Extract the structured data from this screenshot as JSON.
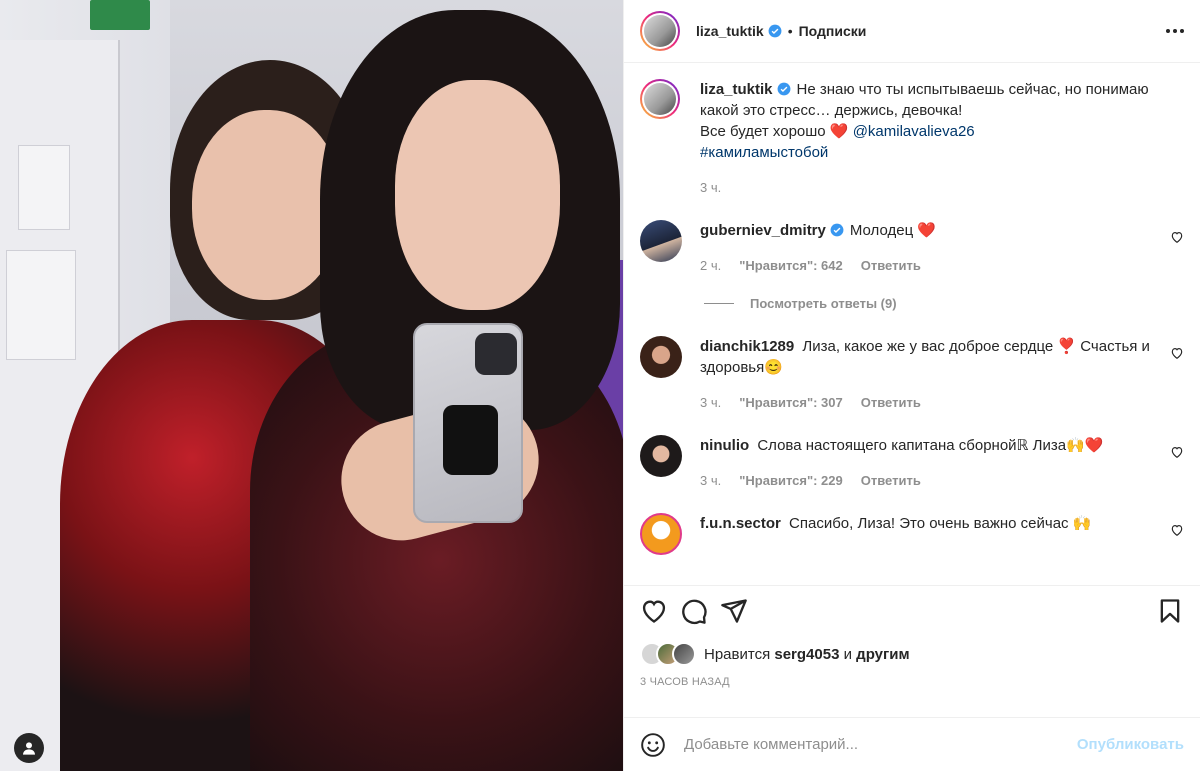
{
  "post": {
    "author": "liza_tuktik",
    "follow_label": "Подписки",
    "caption_line1": "Не знаю что ты испытываешь сейчас, но понимаю",
    "caption_line2": "какой это стресс… держись, девочка!",
    "caption_line3": "Все будет хорошо",
    "caption_heart": "❤️",
    "caption_mention": "@kamilavalieva26",
    "caption_hashtag": "#камиламыстобой",
    "caption_time": "3 ч."
  },
  "comments": [
    {
      "user": "guberniev_dmitry",
      "verified": true,
      "text": "Молодец",
      "emoji": "❤️",
      "time": "2 ч.",
      "likes": "\"Нравится\": 642",
      "reply": "Ответить"
    },
    {
      "user": "dianchik1289",
      "text": "Лиза, какое же у вас доброе сердце ❣️ Счастья и здоровья😊",
      "time": "3 ч.",
      "likes": "\"Нравится\": 307",
      "reply": "Ответить"
    },
    {
      "user": "ninulio",
      "text": "Слова настоящего капитана сборнойℝ Лиза🙌❤️",
      "time": "3 ч.",
      "likes": "\"Нравится\": 229",
      "reply": "Ответить"
    },
    {
      "user": "f.u.n.sector",
      "text": "Спасибо, Лиза! Это очень важно сейчас 🙌"
    }
  ],
  "view_replies": "Посмотреть ответы (9)",
  "likes": {
    "prefix": "Нравится",
    "user": "serg4053",
    "middle": "и",
    "others": "другим"
  },
  "timestamp": "3 ЧАСОВ НАЗАД",
  "add_comment": {
    "placeholder": "Добавьте комментарий...",
    "post_label": "Опубликовать"
  },
  "colors": {
    "verified": "#3897f0",
    "heart_red": "#ed4956",
    "link": "#00376b",
    "muted": "#8e8e8e",
    "post_disabled": "#b2dffc"
  }
}
